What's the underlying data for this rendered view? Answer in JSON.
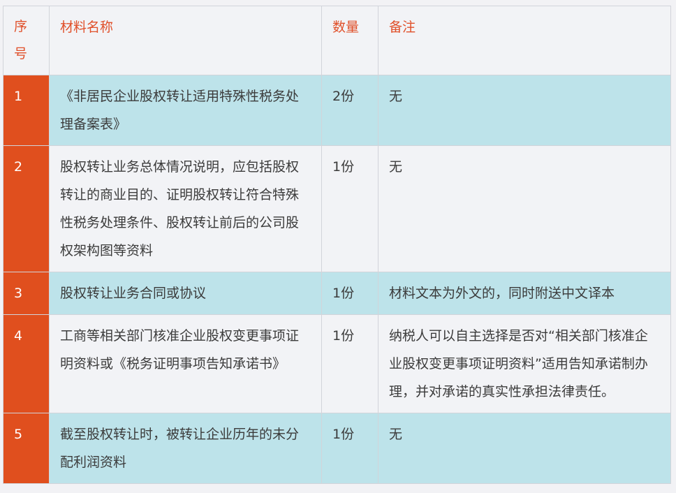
{
  "table": {
    "headers": {
      "seq": "序号",
      "name": "材料名称",
      "qty": "数量",
      "note": "备注"
    },
    "rows": [
      {
        "seq": "1",
        "name": "《非居民企业股权转让适用特殊性税务处理备案表》",
        "qty": "2份",
        "note": "无"
      },
      {
        "seq": "2",
        "name": "股权转让业务总体情况说明，应包括股权转让的商业目的、证明股权转让符合特殊性税务处理条件、股权转让前后的公司股权架构图等资料",
        "qty": "1份",
        "note": "无"
      },
      {
        "seq": "3",
        "name": "股权转让业务合同或协议",
        "qty": "1份",
        "note": "材料文本为外文的，同时附送中文译本"
      },
      {
        "seq": "4",
        "name": "工商等相关部门核准企业股权变更事项证明资料或《税务证明事项告知承诺书》",
        "qty": "1份",
        "note": "纳税人可以自主选择是否对“相关部门核准企业股权变更事项证明资料”适用告知承诺制办理，并对承诺的真实性承担法律责任。"
      },
      {
        "seq": "5",
        "name": "截至股权转让时，被转让企业历年的未分配利润资料",
        "qty": "1份",
        "note": "无"
      }
    ]
  },
  "colors": {
    "header_text": "#e0502a",
    "seq_column_bg": "#e04f1e",
    "odd_row_bg": "#bde3ea",
    "even_row_bg": "#f2f3f6"
  }
}
